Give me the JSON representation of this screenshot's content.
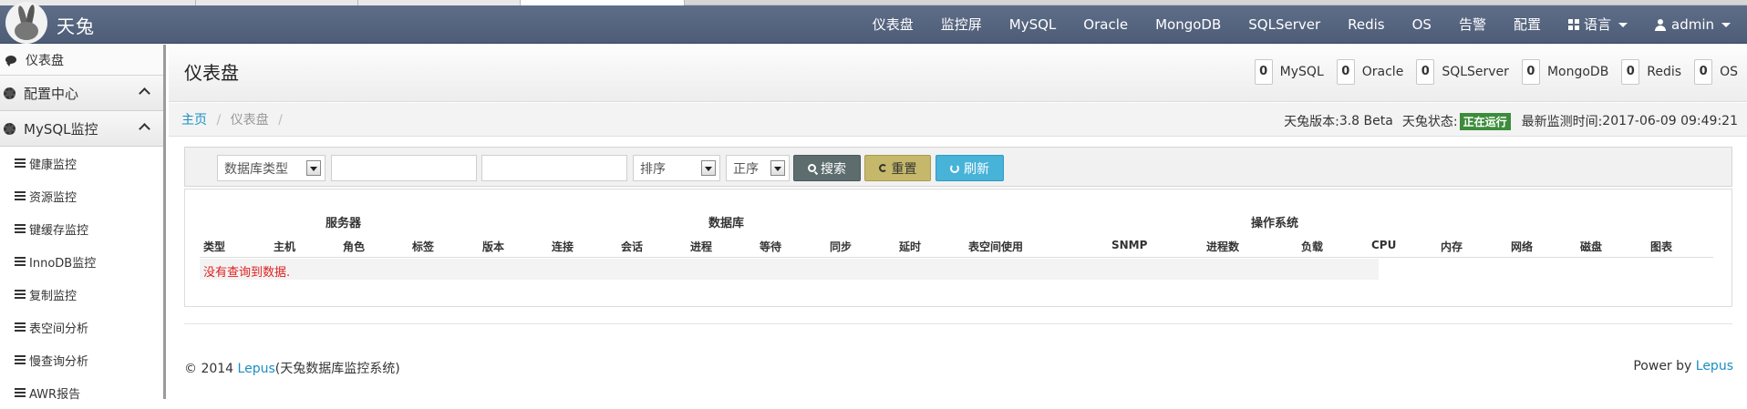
{
  "app": {
    "name": "天兔"
  },
  "navbar": {
    "items": [
      "仪表盘",
      "监控屏",
      "MySQL",
      "Oracle",
      "MongoDB",
      "SQLServer",
      "Redis",
      "OS",
      "告警",
      "配置"
    ],
    "language": "语言",
    "user": "admin"
  },
  "sidebar": {
    "top_item": "仪表盘",
    "sections": [
      {
        "label": "配置中心"
      },
      {
        "label": "MySQL监控"
      }
    ],
    "sub_items": [
      "健康监控",
      "资源监控",
      "键缓存监控",
      "InnoDB监控",
      "复制监控",
      "表空间分析",
      "慢查询分析",
      "AWR报告"
    ]
  },
  "page": {
    "title": "仪表盘",
    "stats": [
      {
        "count": "0",
        "label": "MySQL"
      },
      {
        "count": "0",
        "label": "Oracle"
      },
      {
        "count": "0",
        "label": "SQLServer"
      },
      {
        "count": "0",
        "label": "MongoDB"
      },
      {
        "count": "0",
        "label": "Redis"
      },
      {
        "count": "0",
        "label": "OS"
      }
    ],
    "breadcrumb": {
      "home": "主页",
      "current": "仪表盘",
      "sep": "/"
    },
    "version_label": "天兔版本:",
    "version": "3.8 Beta",
    "status_label": "天兔状态:",
    "status": "正在运行",
    "last_check_label": "最新监测时间:",
    "last_check": "2017-06-09 09:49:21"
  },
  "filters": {
    "db_type": "数据库类型",
    "host_value": "",
    "tags_value": "",
    "sort": "排序",
    "order": "正序",
    "search_button": "搜索",
    "reset_button": "重置",
    "refresh_button": "刷新"
  },
  "table": {
    "groups": [
      "服务器",
      "数据库",
      "操作系统"
    ],
    "headers": [
      "类型",
      "主机",
      "角色",
      "标签",
      "版本",
      "连接",
      "会话",
      "进程",
      "等待",
      "同步",
      "延时",
      "表空间使用",
      "SNMP",
      "进程数",
      "负载",
      "CPU",
      "内存",
      "网络",
      "磁盘",
      "图表"
    ],
    "empty_message": "没有查询到数据."
  },
  "footer": {
    "copyright": "© 2014 ",
    "brand_link": "Lepus",
    "brand_suffix": "(天兔数据库监控系统)",
    "power_prefix": "Power by ",
    "power_link": "Lepus"
  },
  "colors": {
    "navbar": "#546480",
    "link": "#1a8fc3",
    "status_badge": "#3c8c3c",
    "error_text": "#e02020",
    "search_button": "#5d6d6d",
    "reset_button": "#c6b86a",
    "refresh_button": "#48b3d8"
  }
}
